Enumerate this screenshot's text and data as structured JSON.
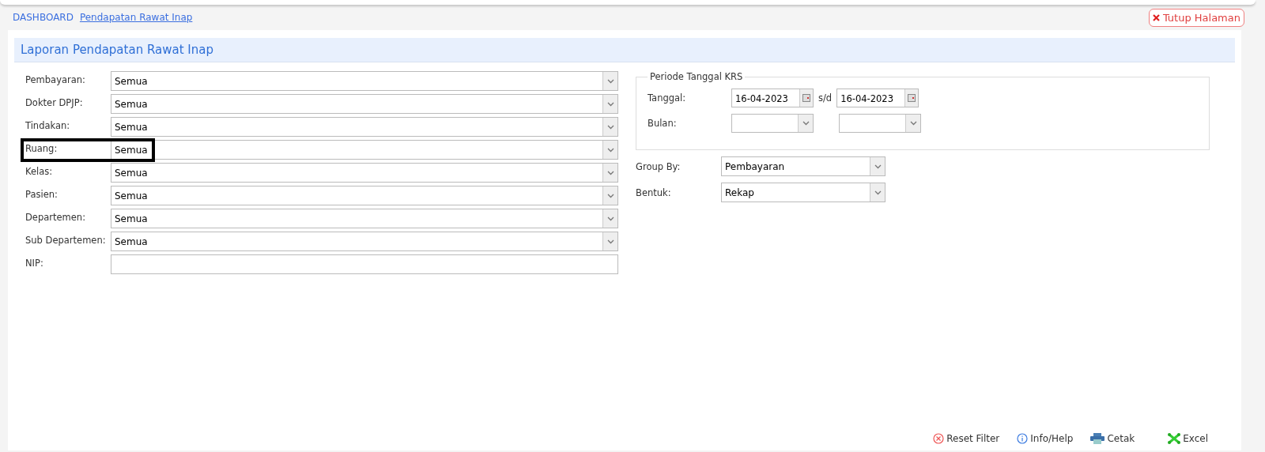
{
  "breadcrumb": [
    {
      "label": "DASHBOARD",
      "selected": false
    },
    {
      "label": "Pendapatan Rawat Inap",
      "selected": true
    }
  ],
  "close_button": {
    "label": "Tutup Halaman"
  },
  "panel": {
    "title": "Laporan Pendapatan Rawat Inap"
  },
  "filters": [
    {
      "label": "Pembayaran:",
      "kind": "select",
      "value": "Semua",
      "highlighted": false
    },
    {
      "label": "Dokter DPJP:",
      "kind": "select",
      "value": "Semua",
      "highlighted": false
    },
    {
      "label": "Tindakan:",
      "kind": "select",
      "value": "Semua",
      "highlighted": false
    },
    {
      "label": "Ruang:",
      "kind": "select",
      "value": "Semua",
      "highlighted": true
    },
    {
      "label": "Kelas:",
      "kind": "select",
      "value": "Semua",
      "highlighted": false
    },
    {
      "label": "Pasien:",
      "kind": "select",
      "value": "Semua",
      "highlighted": false
    },
    {
      "label": "Departemen:",
      "kind": "select",
      "value": "Semua",
      "highlighted": false
    },
    {
      "label": "Sub Departemen:",
      "kind": "select",
      "value": "Semua",
      "highlighted": false
    },
    {
      "label": "NIP:",
      "kind": "text",
      "highlighted": false
    }
  ],
  "period": {
    "legend": "Periode Tanggal KRS",
    "date_label": "Tanggal:",
    "date_from": "16-04-2023",
    "separator": "s/d",
    "date_to": "16-04-2023",
    "month_label": "Bulan:"
  },
  "options": [
    {
      "label": "Group By:",
      "value": "Pembayaran"
    },
    {
      "label": "Bentuk:",
      "value": "Rekap"
    }
  ],
  "actions": [
    {
      "kind": "reset",
      "label": "Reset Filter"
    },
    {
      "kind": "info",
      "label": "Info/Help"
    },
    {
      "kind": "print",
      "label": "Cetak"
    },
    {
      "kind": "excel",
      "label": "Excel"
    }
  ]
}
